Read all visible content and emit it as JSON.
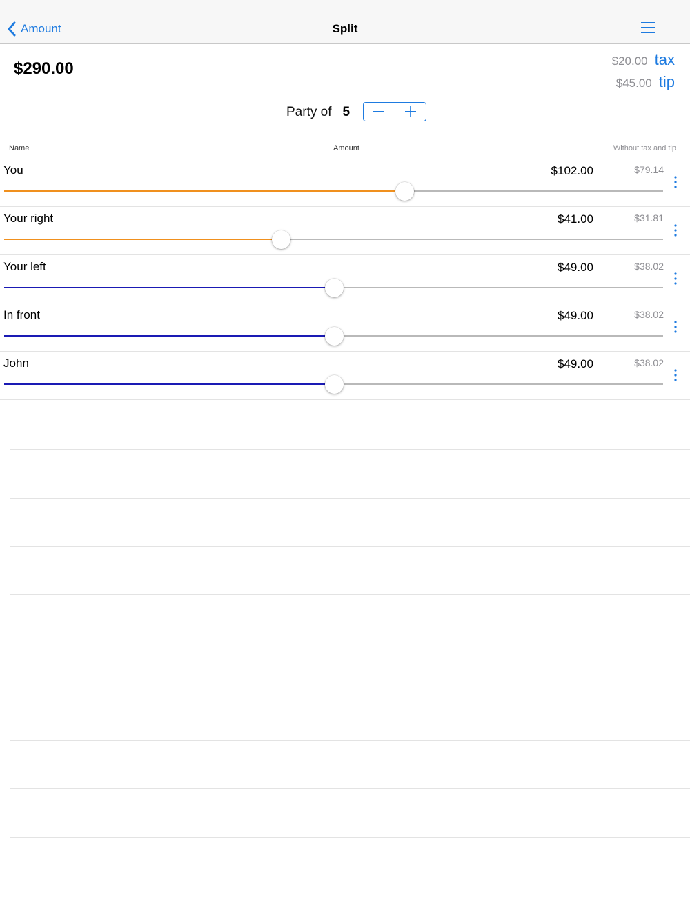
{
  "nav": {
    "back_label": "Amount",
    "title": "Split"
  },
  "summary": {
    "total": "$290.00",
    "tax_value": "$20.00",
    "tax_label": "tax",
    "tip_value": "$45.00",
    "tip_label": "tip"
  },
  "party": {
    "label": "Party of",
    "count": "5"
  },
  "columns": {
    "name": "Name",
    "amount": "Amount",
    "without": "Without tax and tip"
  },
  "colors": {
    "accent": "#1e7be0",
    "modified": "#f0901e",
    "default": "#1a1ab4"
  },
  "people": [
    {
      "name": "You",
      "amount": "$102.00",
      "net": "$79.14",
      "slider_level": 0.607,
      "adjusted": true
    },
    {
      "name": "Your right",
      "amount": "$41.00",
      "net": "$31.81",
      "slider_level": 0.42,
      "adjusted": true
    },
    {
      "name": "Your left",
      "amount": "$49.00",
      "net": "$38.02",
      "slider_level": 0.5,
      "adjusted": false
    },
    {
      "name": "In front",
      "amount": "$49.00",
      "net": "$38.02",
      "slider_level": 0.5,
      "adjusted": false
    },
    {
      "name": "John",
      "amount": "$49.00",
      "net": "$38.02",
      "slider_level": 0.5,
      "adjusted": false
    }
  ]
}
